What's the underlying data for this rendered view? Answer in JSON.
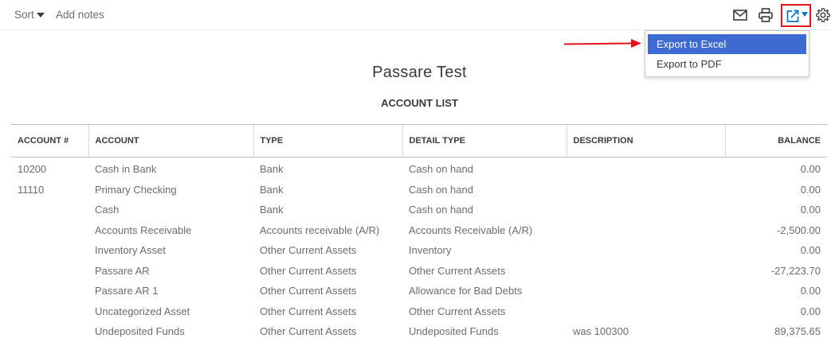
{
  "toolbar": {
    "sort_label": "Sort",
    "add_notes_label": "Add notes"
  },
  "icons": {
    "mail": "mail-icon",
    "print": "print-icon",
    "export": "export-icon",
    "settings": "gear-icon"
  },
  "colors": {
    "accent_blue": "#0077c5",
    "menu_highlight": "#3d6bd1",
    "annotation_red": "#e8121d"
  },
  "export_menu": {
    "items": [
      {
        "label": "Export to Excel",
        "highlighted": true
      },
      {
        "label": "Export to PDF",
        "highlighted": false
      }
    ]
  },
  "report": {
    "company_name": "Passare Test",
    "title": "ACCOUNT LIST",
    "columns": [
      "ACCOUNT #",
      "ACCOUNT",
      "TYPE",
      "DETAIL TYPE",
      "DESCRIPTION",
      "BALANCE"
    ],
    "rows": [
      [
        "10200",
        "Cash in Bank",
        "Bank",
        "Cash on hand",
        "",
        "0.00"
      ],
      [
        "11110",
        "Primary Checking",
        "Bank",
        "Cash on hand",
        "",
        "0.00"
      ],
      [
        "",
        "Cash",
        "Bank",
        "Cash on hand",
        "",
        "0.00"
      ],
      [
        "",
        "Accounts Receivable",
        "Accounts receivable (A/R)",
        "Accounts Receivable (A/R)",
        "",
        "-2,500.00"
      ],
      [
        "",
        "Inventory Asset",
        "Other Current Assets",
        "Inventory",
        "",
        "0.00"
      ],
      [
        "",
        "Passare AR",
        "Other Current Assets",
        "Other Current Assets",
        "",
        "-27,223.70"
      ],
      [
        "",
        "Passare AR 1",
        "Other Current Assets",
        "Allowance for Bad Debts",
        "",
        "0.00"
      ],
      [
        "",
        "Uncategorized Asset",
        "Other Current Assets",
        "Other Current Assets",
        "",
        "0.00"
      ],
      [
        "",
        "Undeposited Funds",
        "Other Current Assets",
        "Undeposited Funds",
        "was 100300",
        "89,375.65"
      ]
    ]
  }
}
